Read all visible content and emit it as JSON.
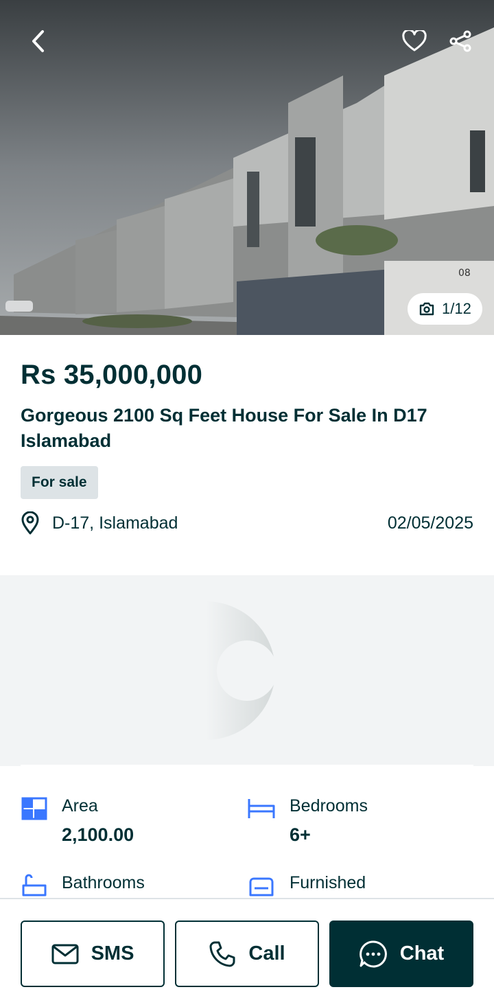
{
  "listing": {
    "price": "Rs 35,000,000",
    "title": "Gorgeous 2100 Sq Feet House For Sale In D17 Islamabad",
    "badge": "For sale",
    "location": "D-17, Islamabad",
    "date": "02/05/2025"
  },
  "gallery": {
    "counter": "1/12",
    "house_number": "08"
  },
  "details": [
    {
      "label": "Area",
      "value": "2,100.00",
      "icon": "area-icon"
    },
    {
      "label": "Bedrooms",
      "value": "6+",
      "icon": "bed-icon"
    },
    {
      "label": "Bathrooms",
      "value": "",
      "icon": "bath-icon"
    },
    {
      "label": "Furnished",
      "value": "",
      "icon": "sofa-icon"
    }
  ],
  "actions": {
    "sms": "SMS",
    "call": "Call",
    "chat": "Chat"
  },
  "colors": {
    "primary": "#002f34",
    "accent_blue": "#3a77ff",
    "badge_bg": "#dde3e6",
    "map_bg": "#f2f4f5"
  }
}
